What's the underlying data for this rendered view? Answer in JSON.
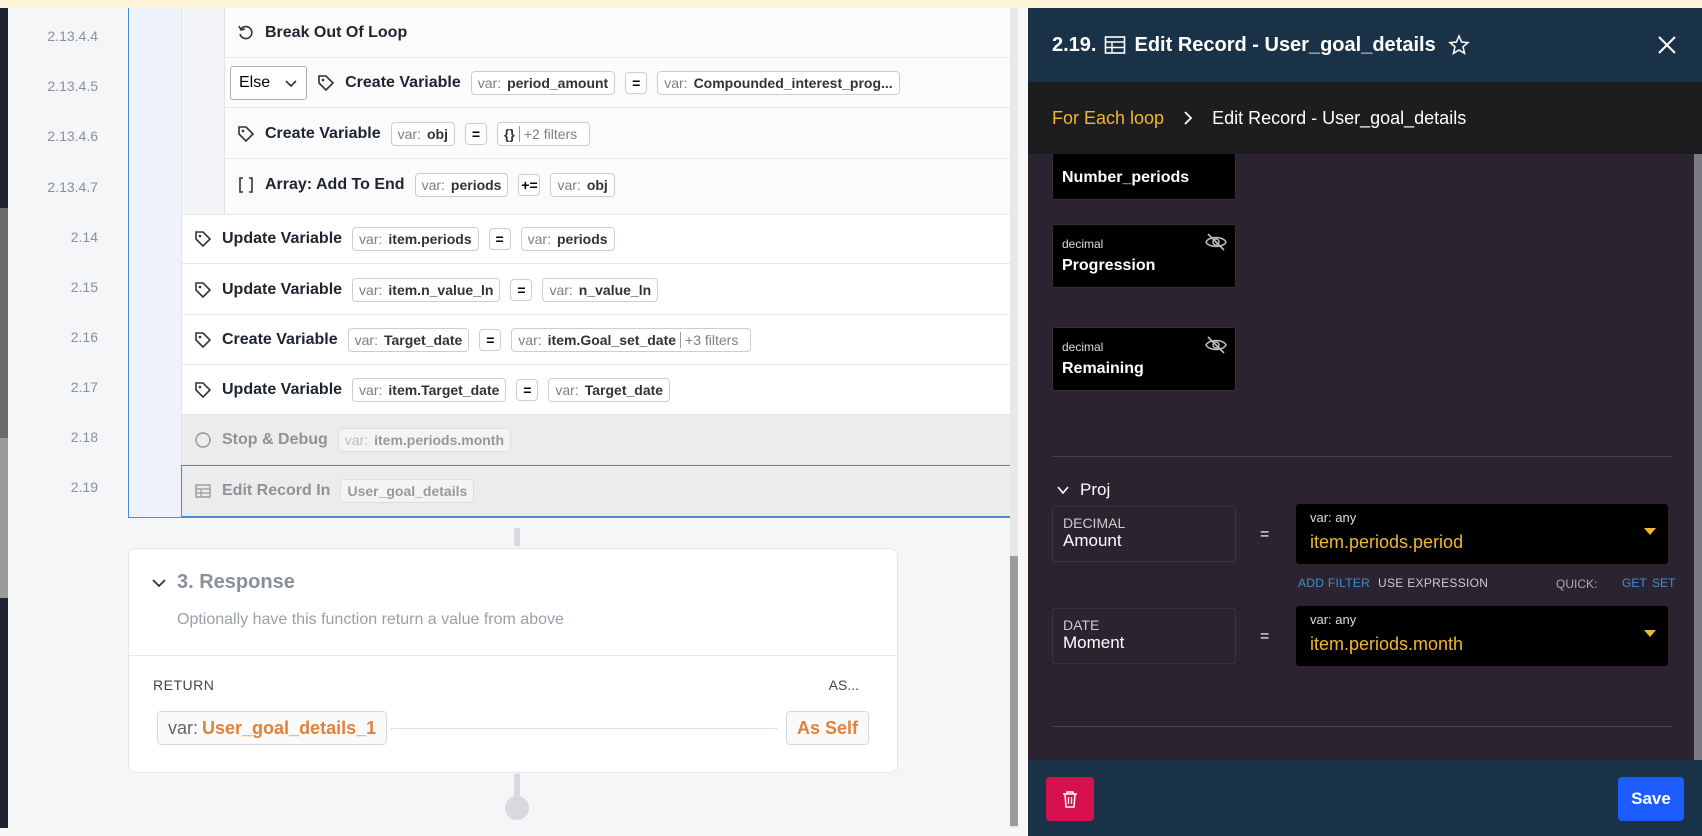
{
  "workflow": {
    "line_numbers": [
      "2.13.4.4",
      "2.13.4.5",
      "2.13.4.6",
      "2.13.4.7",
      "2.14",
      "2.15",
      "2.16",
      "2.17",
      "2.18",
      "2.19"
    ],
    "rows": {
      "break": {
        "title": "Break Out Of Loop"
      },
      "else_row": {
        "else_label": "Else",
        "title": "Create Variable",
        "left_key": "var:",
        "left_val": "period_amount",
        "op": "=",
        "right_key": "var:",
        "right_val": "Compounded_interest_prog..."
      },
      "create_obj": {
        "title": "Create Variable",
        "left_key": "var:",
        "left_val": "obj",
        "op": "=",
        "right_val": "{}",
        "right_filters": "+2 filters"
      },
      "array_add": {
        "title": "Array: Add To End",
        "left_key": "var:",
        "left_val": "periods",
        "op": "+=",
        "right_key": "var:",
        "right_val": "obj"
      },
      "upd_periods": {
        "title": "Update Variable",
        "left_key": "var:",
        "left_val": "item.periods",
        "op": "=",
        "right_key": "var:",
        "right_val": "periods"
      },
      "upd_nvalue": {
        "title": "Update Variable",
        "left_key": "var:",
        "left_val": "item.n_value_ln",
        "op": "=",
        "right_key": "var:",
        "right_val": "n_value_ln"
      },
      "create_target": {
        "title": "Create Variable",
        "left_key": "var:",
        "left_val": "Target_date",
        "op": "=",
        "right_key": "var:",
        "right_val": "item.Goal_set_date",
        "right_filters": "+3 filters"
      },
      "upd_target": {
        "title": "Update Variable",
        "left_key": "var:",
        "left_val": "item.Target_date",
        "op": "=",
        "right_key": "var:",
        "right_val": "Target_date"
      },
      "stop_debug": {
        "title": "Stop & Debug",
        "arg_key": "var:",
        "arg_val": "item.periods.month"
      },
      "edit_record": {
        "title": "Edit Record In",
        "arg_val": "User_goal_details"
      }
    }
  },
  "response": {
    "heading": "3. Response",
    "subtitle": "Optionally have this function return a value from above",
    "return_label": "RETURN",
    "as_label": "AS...",
    "return_key": "var:",
    "return_val": "User_goal_details_1",
    "as_value": "As Self"
  },
  "panel": {
    "number": "2.19.",
    "title": "Edit Record - User_goal_details",
    "breadcrumb_parent": "For Each loop",
    "breadcrumb_current": "Edit Record - User_goal_details",
    "fields": [
      {
        "type": "",
        "name": "Number_periods"
      },
      {
        "type": "decimal",
        "name": "Progression"
      },
      {
        "type": "decimal",
        "name": "Remaining"
      }
    ],
    "section_title": "Proj",
    "assignments": [
      {
        "type": "DECIMAL",
        "name": "Amount",
        "eq": "=",
        "value_type": "var: any",
        "value": "item.periods.period"
      },
      {
        "type": "DATE",
        "name": "Moment",
        "eq": "=",
        "value_type": "var: any",
        "value": "item.periods.month"
      }
    ],
    "add_filter": "ADD FILTER",
    "use_expression": "USE EXPRESSION",
    "quick_label": "QUICK:",
    "quick_get": "GET",
    "quick_set": "SET",
    "save_label": "Save"
  },
  "colors": {
    "accent_orange": "#e2813a",
    "breadcrumb_gold": "#f4b52c",
    "value_gold": "#f1b730",
    "save_blue": "#1d5cff",
    "delete_red": "#d6104e",
    "panel_header": "#1a3247"
  }
}
